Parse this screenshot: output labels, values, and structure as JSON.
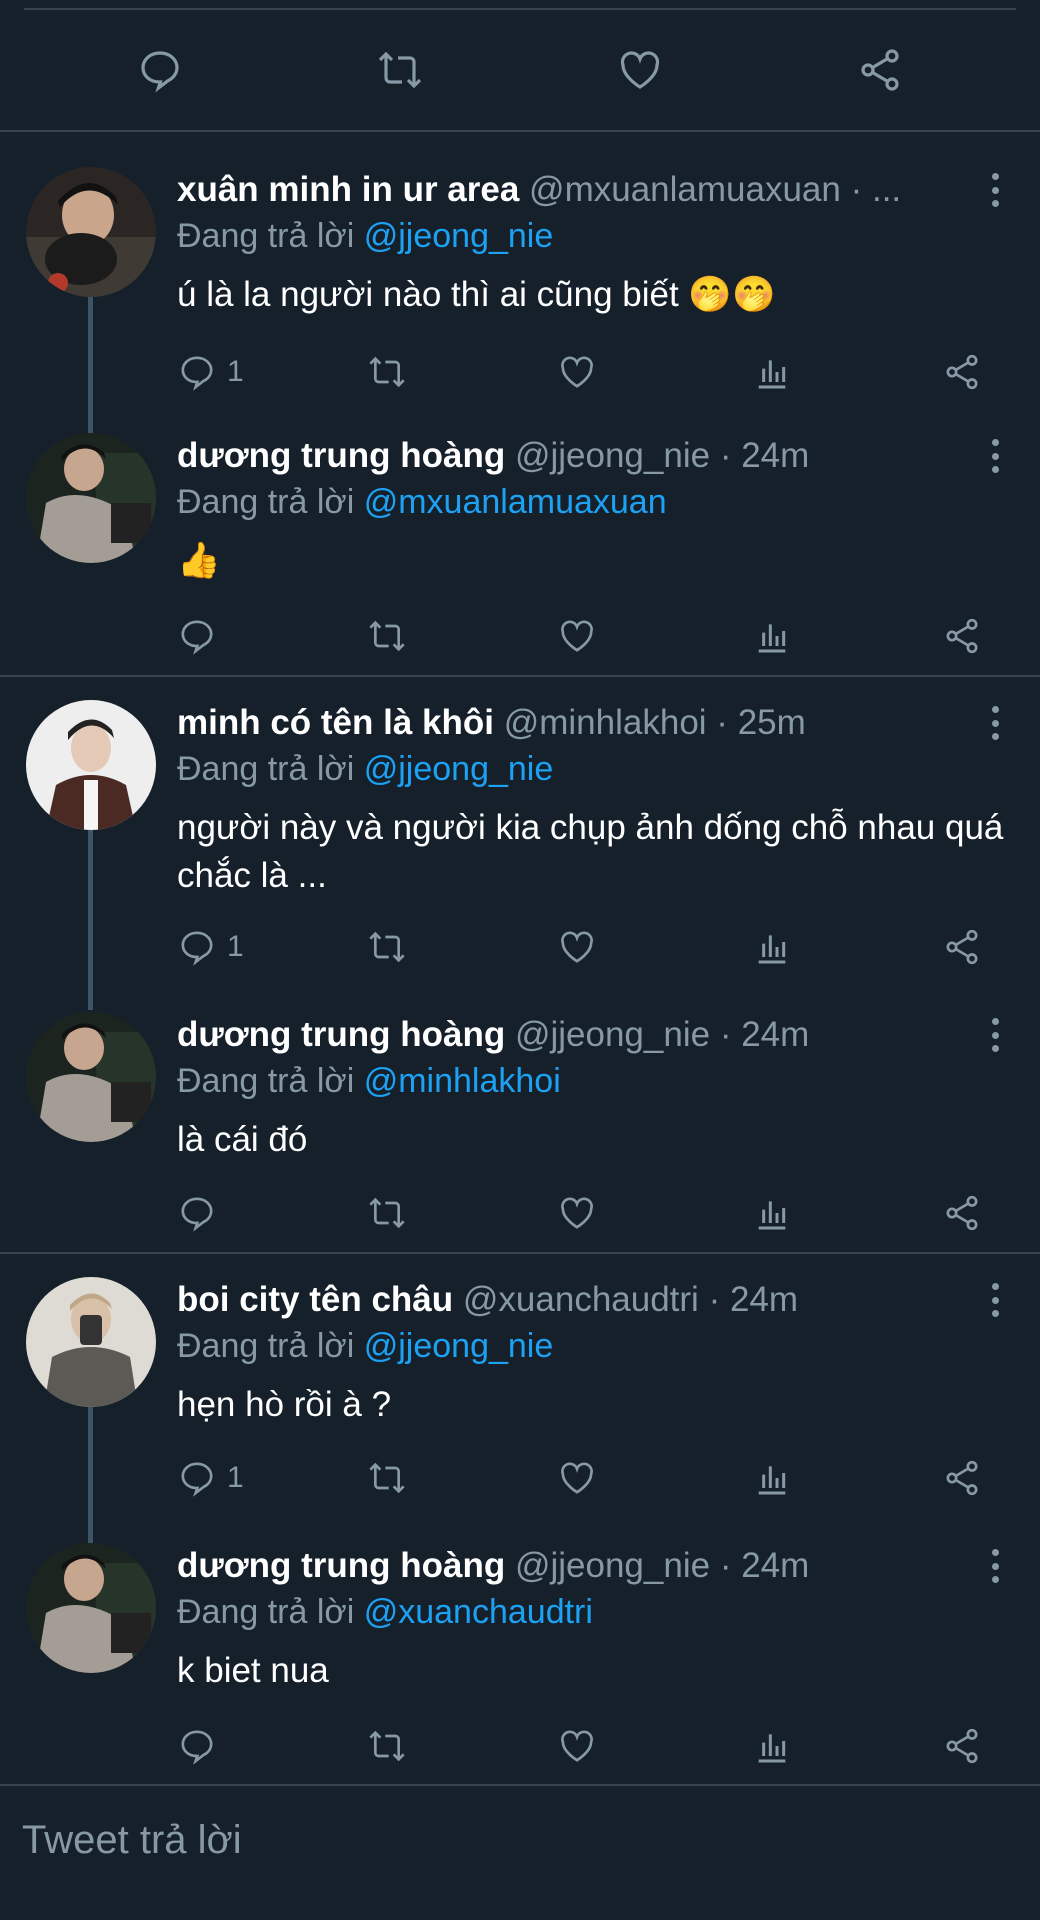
{
  "top_actions": [
    "reply-icon",
    "retweet-icon",
    "like-icon",
    "share-icon"
  ],
  "colors": {
    "background": "#15202b",
    "accent": "#1da1f2",
    "muted": "#8899a6"
  },
  "tweets": [
    {
      "name": "xuân minh in ur area",
      "handle": "@mxuanlamuaxuan",
      "dot": "·",
      "time": "...",
      "reply_prefix": "Đang trả lời",
      "reply_to": "@jjeong_nie",
      "text": "ú là la người nào thì ai cũng biết 🤭🤭",
      "reply_count": "1"
    },
    {
      "name": "dương trung hoàng",
      "handle": "@jjeong_nie",
      "dot": "·",
      "time": "24m",
      "reply_prefix": "Đang trả lời",
      "reply_to": "@mxuanlamuaxuan",
      "text": "👍",
      "reply_count": ""
    },
    {
      "name": "minh có tên là khôi",
      "handle": "@minhlakhoi",
      "dot": "·",
      "time": "25m",
      "reply_prefix": "Đang trả lời",
      "reply_to": "@jjeong_nie",
      "text": "người này và người kia chụp ảnh dống chỗ nhau quá chắc là ...",
      "reply_count": "1"
    },
    {
      "name": "dương trung hoàng",
      "handle": "@jjeong_nie",
      "dot": "·",
      "time": "24m",
      "reply_prefix": "Đang trả lời",
      "reply_to": "@minhlakhoi",
      "text": "là cái đó",
      "reply_count": ""
    },
    {
      "name": "boi city tên châu",
      "handle": "@xuanchaudtri",
      "dot": "·",
      "time": "24m",
      "reply_prefix": "Đang trả lời",
      "reply_to": "@jjeong_nie",
      "text": "hẹn hò rồi à ?",
      "reply_count": "1"
    },
    {
      "name": "dương trung hoàng",
      "handle": "@jjeong_nie",
      "dot": "·",
      "time": "24m",
      "reply_prefix": "Đang trả lời",
      "reply_to": "@xuanchaudtri",
      "text": "k biet nua",
      "reply_count": ""
    }
  ],
  "compose": {
    "placeholder": "Tweet trả lời"
  }
}
